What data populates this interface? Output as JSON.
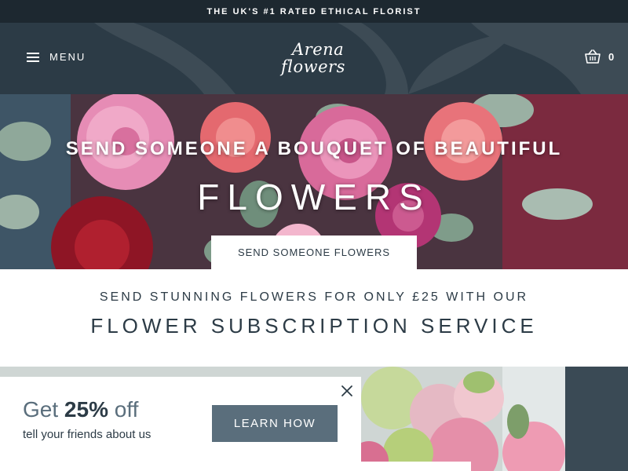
{
  "announcement": {
    "text": "THE UK'S #1 RATED ETHICAL FLORIST"
  },
  "header": {
    "menu_label": "MENU",
    "logo": {
      "line1": "Arena",
      "line2": "flowers"
    },
    "cart_count": "0",
    "icons": {
      "menu": "hamburger-icon",
      "cart": "basket-icon"
    }
  },
  "hero": {
    "title_line1": "SEND SOMEONE A BOUQUET OF BEAUTIFUL",
    "title_line2": "FLOWERS",
    "cta_label": "SEND SOMEONE FLOWERS"
  },
  "subscription": {
    "line1": "SEND STUNNING FLOWERS FOR ONLY £25 WITH OUR",
    "line2": "FLOWER SUBSCRIPTION SERVICE"
  },
  "promo": {
    "title_prefix": "Get",
    "title_highlight": "25%",
    "title_suffix": "off",
    "subtitle": "tell your friends about us",
    "button_label": "LEARN HOW",
    "close_icon": "close-icon"
  },
  "colors": {
    "topbar": "#1d2830",
    "header": "#2c3b46",
    "accent": "#5a6e7c",
    "text_dark": "#2c3b46"
  }
}
